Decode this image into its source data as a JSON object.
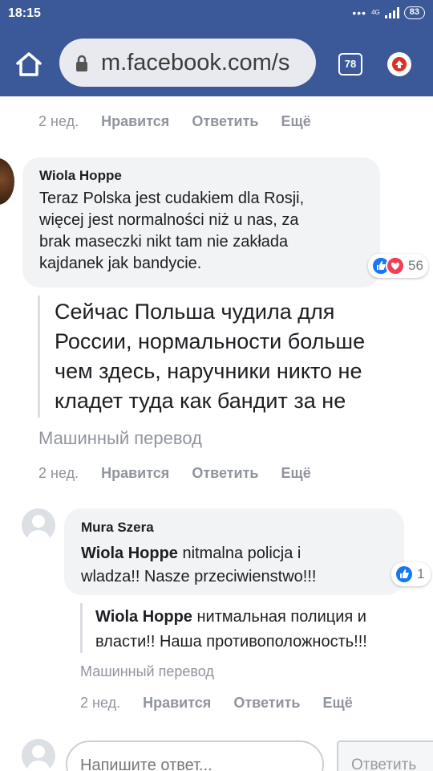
{
  "status_bar": {
    "time": "18:15",
    "network": "4G",
    "battery": "83"
  },
  "browser": {
    "url": "m.facebook.com/s",
    "tab_count": "78"
  },
  "thread": {
    "top_meta": {
      "time": "2 нед.",
      "like": "Нравится",
      "reply": "Ответить",
      "more": "Ещё"
    },
    "comment": {
      "author": "Wiola Hoppe",
      "text_lines": [
        "Teraz Polska jest cudakiem dla Rosji,",
        "więcej jest normalności niż u nas, za",
        "brak maseczki nikt tam nie zakłada",
        "kajdanek jak bandycie."
      ],
      "reaction_count": "56",
      "translation_lines": [
        "Сейчас Польша чудила для",
        "России, нормальности больше",
        "чем здесь, наручники никто не",
        "кладет туда как бандит за не"
      ],
      "machine_label": "Машинный перевод",
      "meta": {
        "time": "2 нед.",
        "like": "Нравится",
        "reply": "Ответить",
        "more": "Ещё"
      }
    },
    "reply": {
      "author": "Mura Szera",
      "mention": "Wiola Hoppe",
      "text_line1_rest": " nitmalna policja i",
      "text_line2": "wladza!! Nasze przeciwienstwo!!!",
      "reaction_count": "1",
      "translation_mention": "Wiola Hoppe",
      "translation_line1_rest": " нитмальная полиция и",
      "translation_line2": "власти!! Наша противоположность!!!",
      "machine_label": "Машинный перевод",
      "meta": {
        "time": "2 нед.",
        "like": "Нравится",
        "reply": "Ответить",
        "more": "Ещё"
      }
    },
    "reply_box": {
      "placeholder": "Напишите ответ...",
      "send_label": "Ответить"
    }
  },
  "colors": {
    "facebook_blue": "#3b5998",
    "like_blue": "#1877f2",
    "love_red": "#f33e58",
    "bubble_gray": "#f2f3f5",
    "meta_gray": "#90949c"
  },
  "icons": [
    "home-icon",
    "lock-icon",
    "tabs-icon",
    "update-icon",
    "like-icon",
    "love-icon"
  ]
}
